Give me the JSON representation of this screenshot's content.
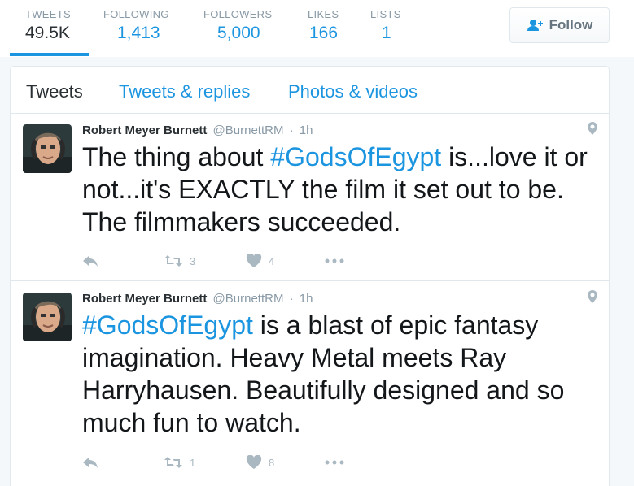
{
  "profile_nav": {
    "stats": [
      {
        "label": "TWEETS",
        "value": "49.5K"
      },
      {
        "label": "FOLLOWING",
        "value": "1,413"
      },
      {
        "label": "FOLLOWERS",
        "value": "5,000"
      },
      {
        "label": "LIKES",
        "value": "166"
      },
      {
        "label": "LISTS",
        "value": "1"
      }
    ],
    "follow_label": "Follow"
  },
  "tabs": [
    "Tweets",
    "Tweets & replies",
    "Photos & videos"
  ],
  "tweets": [
    {
      "fullname": "Robert Meyer Burnett",
      "username": "@BurnettRM",
      "dot": "·",
      "time": "1h",
      "hashtag": "#GodsOfEgypt",
      "text_before": "The thing about ",
      "text_after": " is...love it or not...it's EXACTLY the film it set out to be. The filmmakers succeeded.",
      "retweets": "3",
      "likes": "4"
    },
    {
      "fullname": "Robert Meyer Burnett",
      "username": "@BurnettRM",
      "dot": "·",
      "time": "1h",
      "hashtag": "#GodsOfEgypt",
      "text_before": "",
      "text_after": " is a blast of epic fantasy imagination. Heavy Metal meets Ray Harryhausen. Beautifully designed and so much fun to watch.",
      "retweets": "1",
      "likes": "8"
    }
  ],
  "colors": {
    "accent": "#1b95e0",
    "text": "#14171a",
    "muted": "#8899a6",
    "icon": "#aab8c2",
    "border": "#e1e8ed"
  }
}
